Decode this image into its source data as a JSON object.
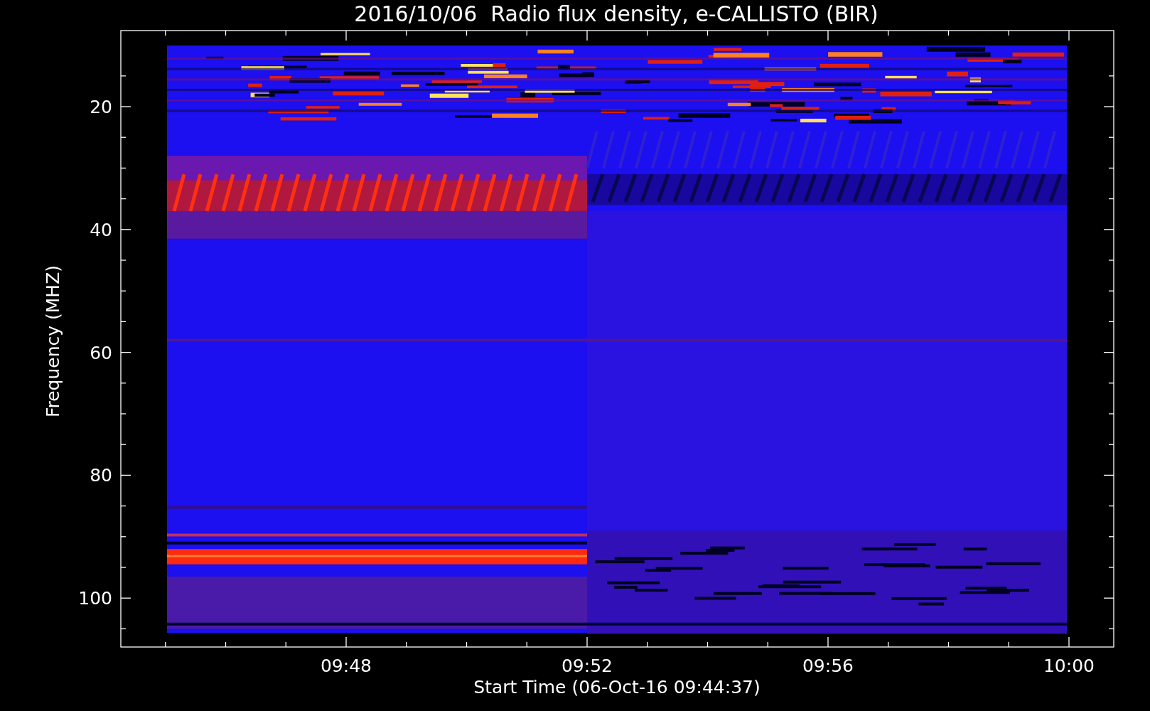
{
  "plot": {
    "title": "2016/10/06  Radio flux density, e-CALLISTO (BIR)",
    "ylabel": "Frequency (MHZ)",
    "xlabel": "Start Time (06-Oct-16 09:44:37)",
    "y_tick_labels": [
      "20",
      "40",
      "60",
      "80",
      "100"
    ],
    "x_tick_labels": [
      "09:48",
      "09:52",
      "09:56",
      "10:00"
    ]
  }
}
